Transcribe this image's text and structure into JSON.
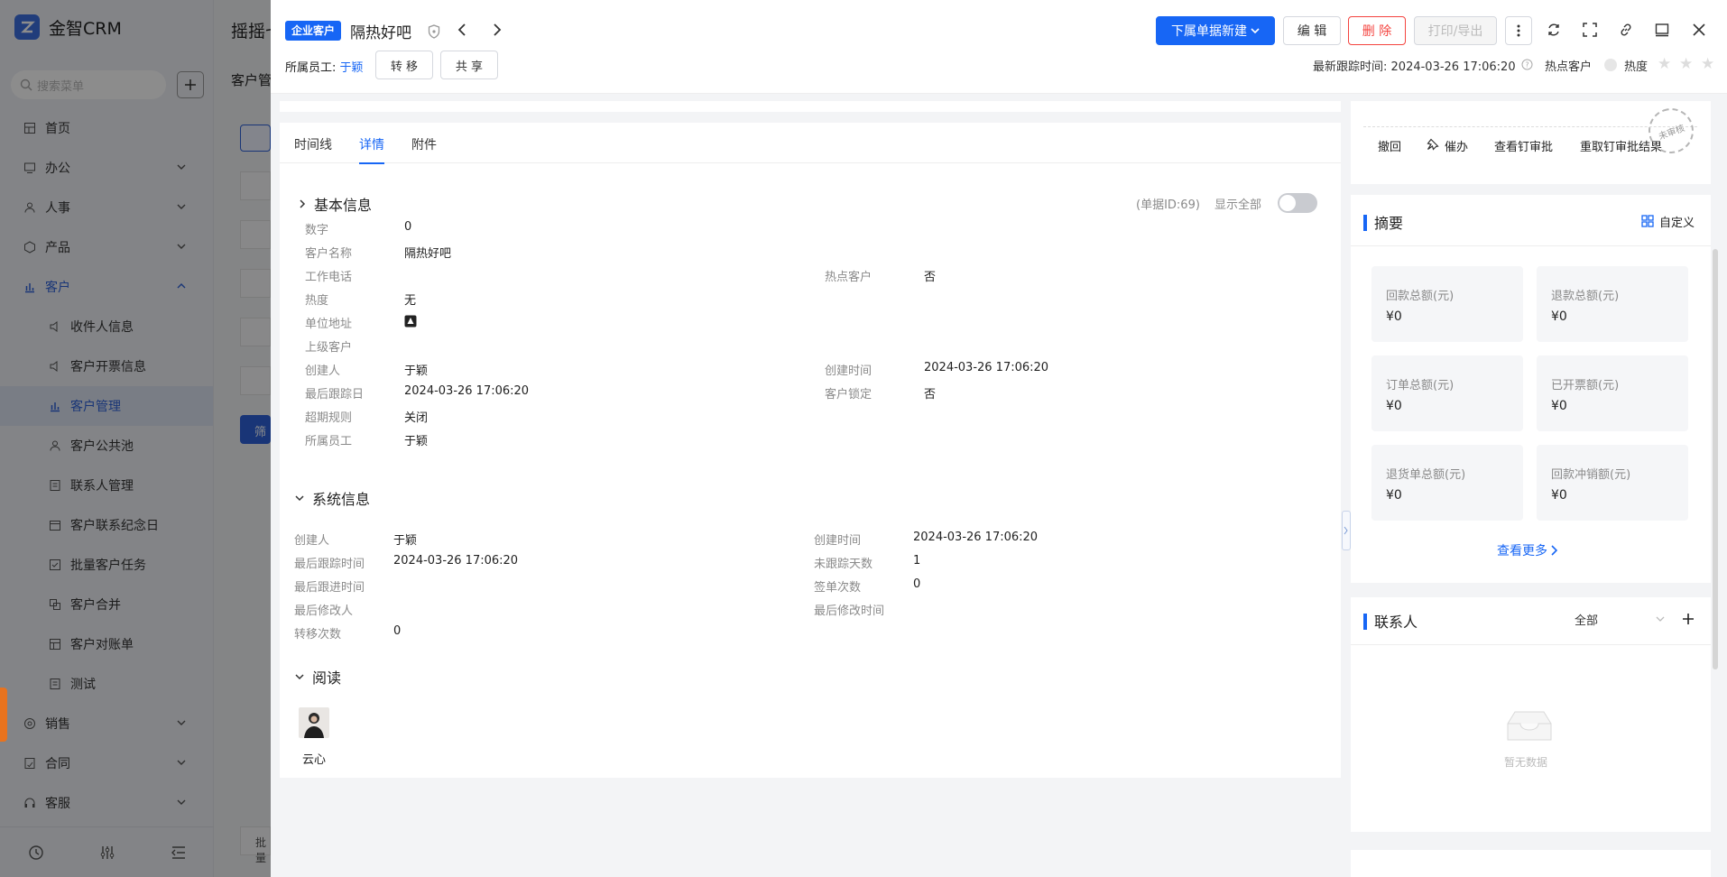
{
  "app": {
    "name": "金智CRM"
  },
  "sidebar": {
    "search_placeholder": "搜索菜单",
    "items": [
      {
        "label": "首页"
      },
      {
        "label": "办公"
      },
      {
        "label": "人事"
      },
      {
        "label": "产品"
      },
      {
        "label": "客户"
      },
      {
        "label": "收件人信息"
      },
      {
        "label": "客户开票信息"
      },
      {
        "label": "客户管理"
      },
      {
        "label": "客户公共池"
      },
      {
        "label": "联系人管理"
      },
      {
        "label": "客户联系纪念日"
      },
      {
        "label": "批量客户任务"
      },
      {
        "label": "客户合并"
      },
      {
        "label": "客户对账单"
      },
      {
        "label": "测试"
      },
      {
        "label": "销售"
      },
      {
        "label": "合同"
      },
      {
        "label": "客服"
      }
    ]
  },
  "background": {
    "breadcrumb": "摇摇七",
    "page_title": "客户管",
    "filter_btn": "筛",
    "batch_btn": "批量"
  },
  "header": {
    "tag": "企业客户",
    "title": "隔热好吧",
    "buttons": {
      "new_sub": "下属单据新建",
      "edit": "编 辑",
      "delete": "删 除",
      "print": "打印/导出"
    },
    "owner_label": "所属员工:",
    "owner_name": "于颖",
    "transfer": "转 移",
    "share": "共 享",
    "last_follow_label": "最新跟踪时间:",
    "last_follow_time": "2024-03-26 17:06:20",
    "hot_customer_label": "热点客户",
    "heat_label": "热度",
    "heat_stars": 0
  },
  "tabs": [
    {
      "label": "时间线"
    },
    {
      "label": "详情"
    },
    {
      "label": "附件"
    }
  ],
  "basic": {
    "title": "基本信息",
    "doc_id": "(单据ID:69)",
    "show_all": "显示全部",
    "fields": {
      "digit": {
        "label": "数字",
        "value": "0"
      },
      "name": {
        "label": "客户名称",
        "value": "隔热好吧"
      },
      "phone": {
        "label": "工作电话",
        "value": ""
      },
      "hot": {
        "label": "热点客户",
        "value": "否"
      },
      "heat": {
        "label": "热度",
        "value": "无"
      },
      "address": {
        "label": "单位地址"
      },
      "parent": {
        "label": "上级客户",
        "value": ""
      },
      "creator": {
        "label": "创建人",
        "value": "于颖"
      },
      "created": {
        "label": "创建时间",
        "value": "2024-03-26 17:06:20"
      },
      "last_follow_date": {
        "label": "最后跟踪日",
        "value": "2024-03-26 17:06:20"
      },
      "locked": {
        "label": "客户锁定",
        "value": "否"
      },
      "overdue": {
        "label": "超期规则",
        "value": "关闭"
      },
      "owner": {
        "label": "所属员工",
        "value": "于颖"
      }
    }
  },
  "system": {
    "title": "系统信息",
    "fields": {
      "creator": {
        "label": "创建人",
        "value": "于颖"
      },
      "created": {
        "label": "创建时间",
        "value": "2024-03-26 17:06:20"
      },
      "last_follow": {
        "label": "最后跟踪时间",
        "value": "2024-03-26 17:06:20"
      },
      "unfollow_days": {
        "label": "未跟踪天数",
        "value": "1"
      },
      "last_progress": {
        "label": "最后跟进时间",
        "value": ""
      },
      "sign_count": {
        "label": "签单次数",
        "value": "0"
      },
      "last_modifier": {
        "label": "最后修改人",
        "value": ""
      },
      "last_modified": {
        "label": "最后修改时间",
        "value": ""
      },
      "transfer_count": {
        "label": "转移次数",
        "value": "0"
      }
    }
  },
  "read": {
    "title": "阅读",
    "user": "云心"
  },
  "approval": {
    "revoke": "撤回",
    "urge": "催办",
    "view_ding": "查看钉审批",
    "refetch": "重取钉审批结果",
    "stamp": "未审核"
  },
  "summary": {
    "title": "摘要",
    "customize": "自定义",
    "stats": [
      {
        "label": "回款总额(元)",
        "value": "¥0"
      },
      {
        "label": "退款总额(元)",
        "value": "¥0"
      },
      {
        "label": "订单总额(元)",
        "value": "¥0"
      },
      {
        "label": "已开票额(元)",
        "value": "¥0"
      },
      {
        "label": "退货单总额(元)",
        "value": "¥0"
      },
      {
        "label": "回款冲销额(元)",
        "value": "¥0"
      }
    ],
    "more": "查看更多"
  },
  "contacts": {
    "title": "联系人",
    "filter": "全部",
    "empty": "暂无数据"
  }
}
